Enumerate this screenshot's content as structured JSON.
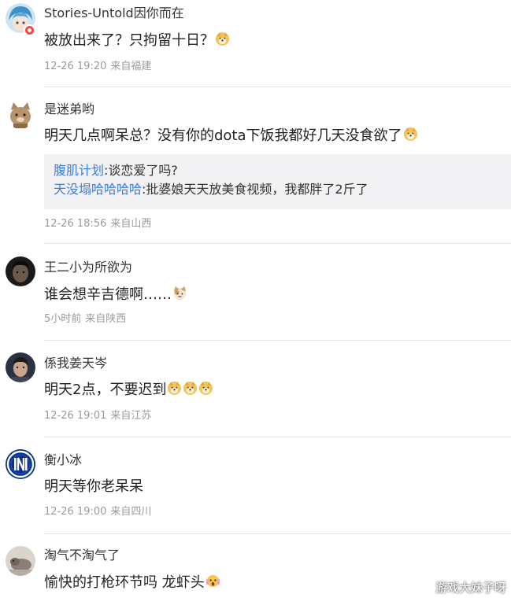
{
  "comments": [
    {
      "username": "Stories-Untold因你而在",
      "text": "被放出来了？只拘留十日？",
      "emoji": [
        "doge-icon"
      ],
      "time": "12-26 19:20",
      "location": "来自福建",
      "avatar": "anime-avatar"
    },
    {
      "username": "是迷弟哟",
      "text": "明天几点啊呆总？没有你的dota下饭我都好几天没食欲了",
      "emoji": [
        "doge-icon"
      ],
      "time": "12-26 18:56",
      "location": "来自山西",
      "avatar": "cat-avatar",
      "replies": [
        {
          "user": "腹肌计划",
          "text": ":谈恋爱了吗?"
        },
        {
          "user": "天没塌哈哈哈哈",
          "text": ":批婆娘天天放美食视频，我都胖了2斤了"
        }
      ]
    },
    {
      "username": "王二小为所欲为",
      "text": "谁会想辛吉德啊……",
      "emoji": [
        "cat-emoji-icon"
      ],
      "time": "5小时前",
      "location": "来自陕西",
      "avatar": "man-avatar"
    },
    {
      "username": "係我姜天岑",
      "text": "明天2点，不要迟到",
      "emoji": [
        "doge-icon",
        "doge-icon",
        "doge-icon"
      ],
      "time": "12-26 19:01",
      "location": "来自江苏",
      "avatar": "portrait-avatar"
    },
    {
      "username": "衡小冰",
      "text": "明天等你老呆呆",
      "emoji": [],
      "time": "12-26 19:00",
      "location": "来自四川",
      "avatar": "inter-logo-avatar"
    },
    {
      "username": "淘气不淘气了",
      "text": "愉快的打枪环节吗 龙虾头",
      "emoji": [
        "shocked-emoji-icon"
      ],
      "avatar": "animal-avatar"
    }
  ],
  "watermark": "游戏大妹子呀",
  "colors": {
    "reply_user": "#3b7dd8",
    "meta": "#9a9a9a",
    "reply_bg": "#f2f2f5",
    "badge": "#f04b3b"
  }
}
